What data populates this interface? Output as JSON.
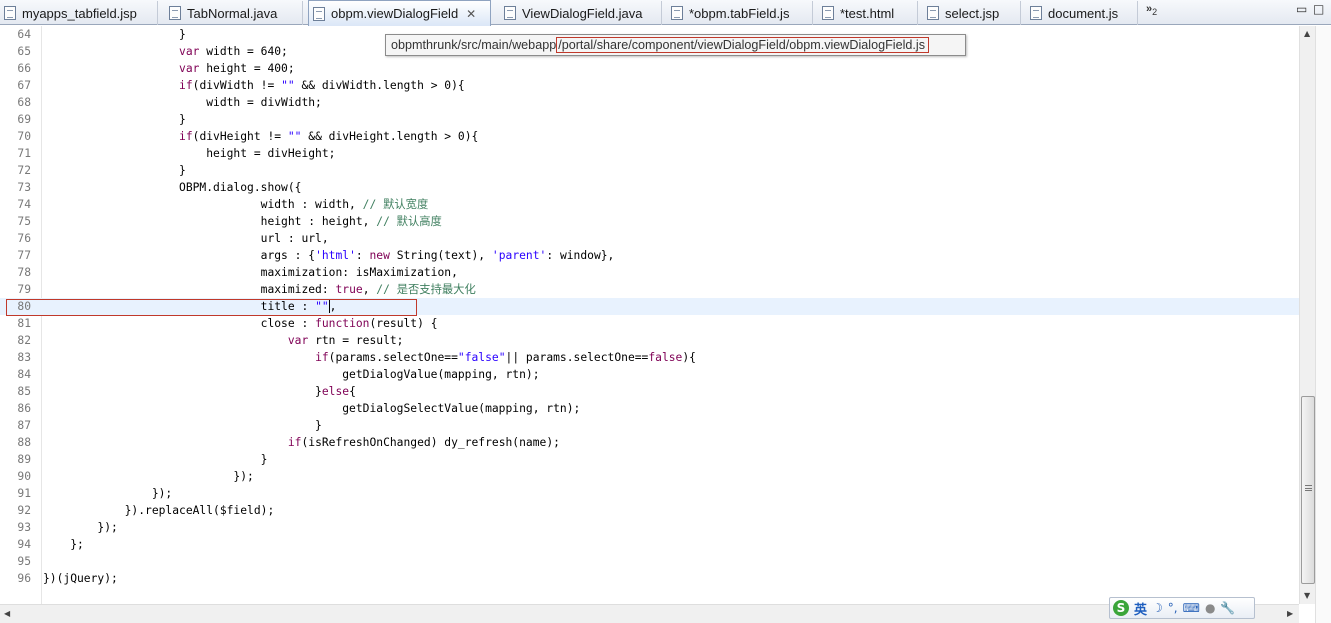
{
  "tabs": [
    {
      "label": "myapps_tabfield.jsp",
      "active": false
    },
    {
      "label": "TabNormal.java",
      "active": false
    },
    {
      "label": "obpm.viewDialogField",
      "active": true
    },
    {
      "label": "ViewDialogField.java",
      "active": false
    },
    {
      "label": "*obpm.tabField.js",
      "active": false
    },
    {
      "label": "*test.html",
      "active": false
    },
    {
      "label": "select.jsp",
      "active": false
    },
    {
      "label": "document.js",
      "active": false
    }
  ],
  "overflow": {
    "glyph": "»",
    "count": "2"
  },
  "window_controls": {
    "minimize": "▭",
    "maximize": "□"
  },
  "tooltip": {
    "prefix": "obpmthrunk/src/main/webapp",
    "highlight": "/portal/share/component/viewDialogField/obpm.viewDialogField.js"
  },
  "editor": {
    "current_line": 80,
    "lines": [
      {
        "n": "64",
        "html": "                    }"
      },
      {
        "n": "65",
        "html": "                    <span class=\"kw\">var</span> width = 640;"
      },
      {
        "n": "66",
        "html": "                    <span class=\"kw\">var</span> height = 400;"
      },
      {
        "n": "67",
        "html": "                    <span class=\"kw\">if</span>(divWidth != <span class=\"str\">\"\"</span> &amp;&amp; divWidth.length &gt; 0){"
      },
      {
        "n": "68",
        "html": "                        width = divWidth;"
      },
      {
        "n": "69",
        "html": "                    }"
      },
      {
        "n": "70",
        "html": "                    <span class=\"kw\">if</span>(divHeight != <span class=\"str\">\"\"</span> &amp;&amp; divHeight.length &gt; 0){"
      },
      {
        "n": "71",
        "html": "                        height = divHeight;"
      },
      {
        "n": "72",
        "html": "                    }"
      },
      {
        "n": "73",
        "html": "                    OBPM.dialog.show({"
      },
      {
        "n": "74",
        "html": "                                width : width, <span class=\"cmt\">// 默认宽度</span>"
      },
      {
        "n": "75",
        "html": "                                height : height, <span class=\"cmt\">// 默认高度</span>"
      },
      {
        "n": "76",
        "html": "                                url : url,"
      },
      {
        "n": "77",
        "html": "                                args : {<span class=\"str\">'html'</span>: <span class=\"kw\">new</span> String(text), <span class=\"str\">'parent'</span>: window},"
      },
      {
        "n": "78",
        "html": "                                maximization: isMaximization,"
      },
      {
        "n": "79",
        "html": "                                maximized: <span class=\"kw\">true</span>, <span class=\"cmt\">// 是否支持最大化</span>"
      },
      {
        "n": "80",
        "html": "                                title : <span class=\"str\">\"\"</span><span class=\"caret\"></span>,"
      },
      {
        "n": "81",
        "html": "                                close : <span class=\"kw\">function</span>(result) {"
      },
      {
        "n": "82",
        "html": "                                    <span class=\"kw\">var</span> rtn = result;"
      },
      {
        "n": "83",
        "html": "                                        <span class=\"kw\">if</span>(params.selectOne==<span class=\"str\">\"false\"</span>|| params.selectOne==<span class=\"kw\">false</span>){"
      },
      {
        "n": "84",
        "html": "                                            getDialogValue(mapping, rtn);"
      },
      {
        "n": "85",
        "html": "                                        }<span class=\"kw\">else</span>{"
      },
      {
        "n": "86",
        "html": "                                            getDialogSelectValue(mapping, rtn);"
      },
      {
        "n": "87",
        "html": "                                        }"
      },
      {
        "n": "88",
        "html": "                                    <span class=\"kw\">if</span>(isRefreshOnChanged) dy_refresh(name);"
      },
      {
        "n": "89",
        "html": "                                }"
      },
      {
        "n": "90",
        "html": "                            });"
      },
      {
        "n": "91",
        "html": "                });"
      },
      {
        "n": "92",
        "html": "            }).replaceAll($field);"
      },
      {
        "n": "93",
        "html": "        });"
      },
      {
        "n": "94",
        "html": "    };"
      },
      {
        "n": "95",
        "html": ""
      },
      {
        "n": "96",
        "html": "})(jQuery);"
      }
    ]
  },
  "ime": {
    "logo": "S",
    "lang": "英",
    "moon": "☽",
    "dots": "°,",
    "keyboard": "⌨",
    "user": "●",
    "wrench": "🔧"
  },
  "scroll": {
    "up": "▲",
    "down": "▼",
    "left": "◀",
    "right": "▶"
  }
}
